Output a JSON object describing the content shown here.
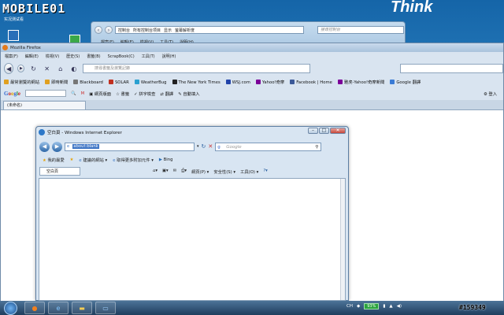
{
  "site": {
    "logo": "MOBILE01",
    "sub": "实况测试看",
    "right_tag": "Think"
  },
  "explorer": {
    "breadcrumbs": [
      "控制台",
      "所有控制台项目",
      "显示",
      "萤幕解析度"
    ],
    "search_placeholder": "搜尋控制台",
    "menu": [
      "檔案(F)",
      "編輯(E)",
      "檢視(V)",
      "工具(T)",
      "說明(H)"
    ]
  },
  "firefox": {
    "title": "Mozilla Firefox",
    "menu": [
      "檔案(F)",
      "編輯(E)",
      "檢視(V)",
      "歷史(S)",
      "書籤(B)",
      "ScrapBook(C)",
      "工具(T)",
      "說明(H)"
    ],
    "url_placeholder": "搜尋書籤及瀏覽記錄",
    "search_placeholder": "",
    "bookmarks": [
      {
        "label": "最常瀏覽的網站",
        "color": "#e0a020"
      },
      {
        "label": "即時新聞",
        "color": "#e0a020"
      },
      {
        "label": "Blackboard",
        "color": "#777777"
      },
      {
        "label": "SOLAR",
        "color": "#c03020"
      },
      {
        "label": "WeatherBug",
        "color": "#2aa0d0"
      },
      {
        "label": "The New York Times",
        "color": "#222222"
      },
      {
        "label": "WSJ.com",
        "color": "#2244aa"
      },
      {
        "label": "Yahoo!奇摩",
        "color": "#7b0099"
      },
      {
        "label": "Facebook | Home",
        "color": "#3b5998"
      },
      {
        "label": "雅虎-Yahoo!奇摩新聞",
        "color": "#7b0099"
      },
      {
        "label": "Google 翻譯",
        "color": "#3a7bd5"
      }
    ],
    "google_bar": {
      "logo": "Google",
      "items": [
        "網頁版面",
        "書籤",
        "拼字檢查",
        "翻譯",
        "自動填入"
      ],
      "right": [
        "登入"
      ]
    },
    "tab_label": "(未命名)"
  },
  "ie": {
    "title": "空白頁 - Windows Internet Explorer",
    "url": "about:blank",
    "search_placeholder": "Google",
    "favorites": [
      "我的最愛",
      "建議的網站",
      "取得更多附加元件",
      "Bing"
    ],
    "tab_label": "空白頁",
    "tools": [
      "網頁(P)",
      "安全性(S)",
      "工具(O)"
    ]
  },
  "taskbar": {
    "tray_lang": "CH",
    "battery": "93%",
    "icons": [
      "start-orb",
      "firefox",
      "internet-explorer",
      "folder",
      "control-panel"
    ]
  },
  "watermark": "#159349"
}
